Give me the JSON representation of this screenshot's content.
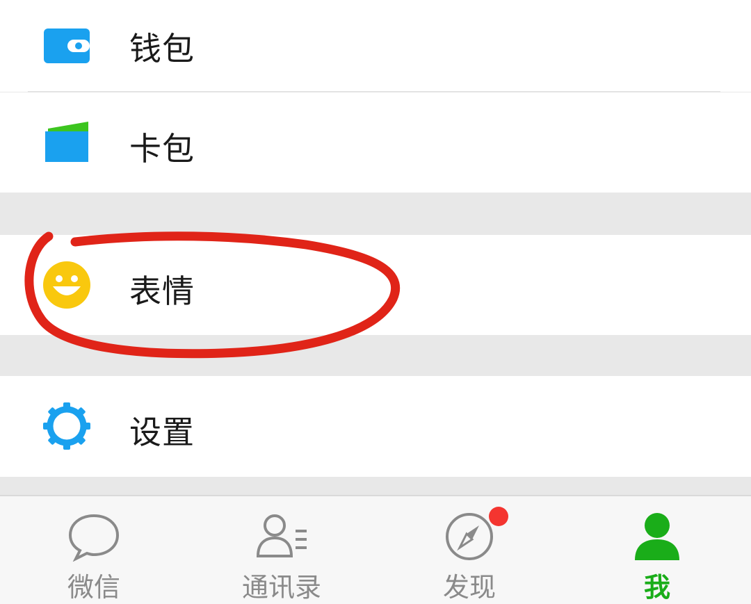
{
  "menu": {
    "wallet": {
      "label": "钱包",
      "icon": "wallet-icon"
    },
    "cards": {
      "label": "卡包",
      "icon": "card-holder-icon"
    },
    "stickers": {
      "label": "表情",
      "icon": "smiley-face-icon"
    },
    "settings": {
      "label": "设置",
      "icon": "gear-icon"
    }
  },
  "tabbar": {
    "tabs": [
      {
        "label": "微信",
        "icon": "chat-bubble-icon",
        "active": false
      },
      {
        "label": "通讯录",
        "icon": "contacts-icon",
        "active": false
      },
      {
        "label": "发现",
        "icon": "compass-icon",
        "active": false,
        "badge": "red-dot"
      },
      {
        "label": "我",
        "icon": "person-icon",
        "active": true
      }
    ]
  },
  "colors": {
    "accent_green": "#1aad19",
    "wallet_blue": "#1aa1ef",
    "sticker_yellow": "#f9c80e",
    "annotation_red": "#e02418",
    "badge_red": "#f43530"
  }
}
